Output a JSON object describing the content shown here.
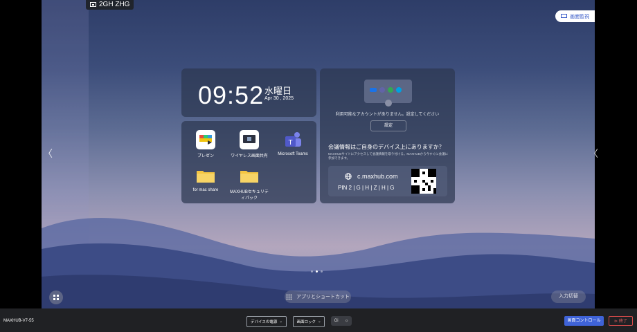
{
  "screen": {
    "room_code": "2GH ZHG",
    "mirror_button": "画面監視",
    "edge_left": "〈",
    "edge_right": "〈"
  },
  "clock": {
    "time": "09:52",
    "weekday": "水曜日",
    "date": "Apr 30 , 2025"
  },
  "apps": [
    {
      "label": "プレゼン",
      "icon": "presentation-icon"
    },
    {
      "label": "ワイヤレス画面共有",
      "icon": "wireless-share-icon"
    },
    {
      "label": "Microsoft Teams",
      "icon": "teams-icon"
    },
    {
      "label": "for mac share",
      "icon": "folder-icon"
    },
    {
      "label": "MAXHUBセキュリティパック",
      "icon": "folder-icon"
    }
  ],
  "accounts": {
    "message": "利用可能なアカウントがありません。設定してください",
    "setup_button": "設定"
  },
  "meeting_info": {
    "question": "会議情報はご自身のデバイス上にありますか？",
    "description": "MAXHUBサイトにアクセスして会議情報を取り付ける。MAXHUBから今すぐに会議に参加できます。",
    "url": "c.maxhub.com",
    "pin": "PIN  2 | G | H | Z | H | G"
  },
  "bottom_overlay": {
    "shortcuts": "アプリとショートカット",
    "input_switch": "入力切替"
  },
  "taskbar": {
    "device_name": "MAXHUB-V7-55",
    "device_power": "デバイスの電源",
    "screen_lock": "画面ロック",
    "toggle_label": "Oi",
    "screen_control": "画面コントロール",
    "end": "終了"
  },
  "colors": {
    "accent": "#3f63d8",
    "danger": "#d84b4b"
  }
}
